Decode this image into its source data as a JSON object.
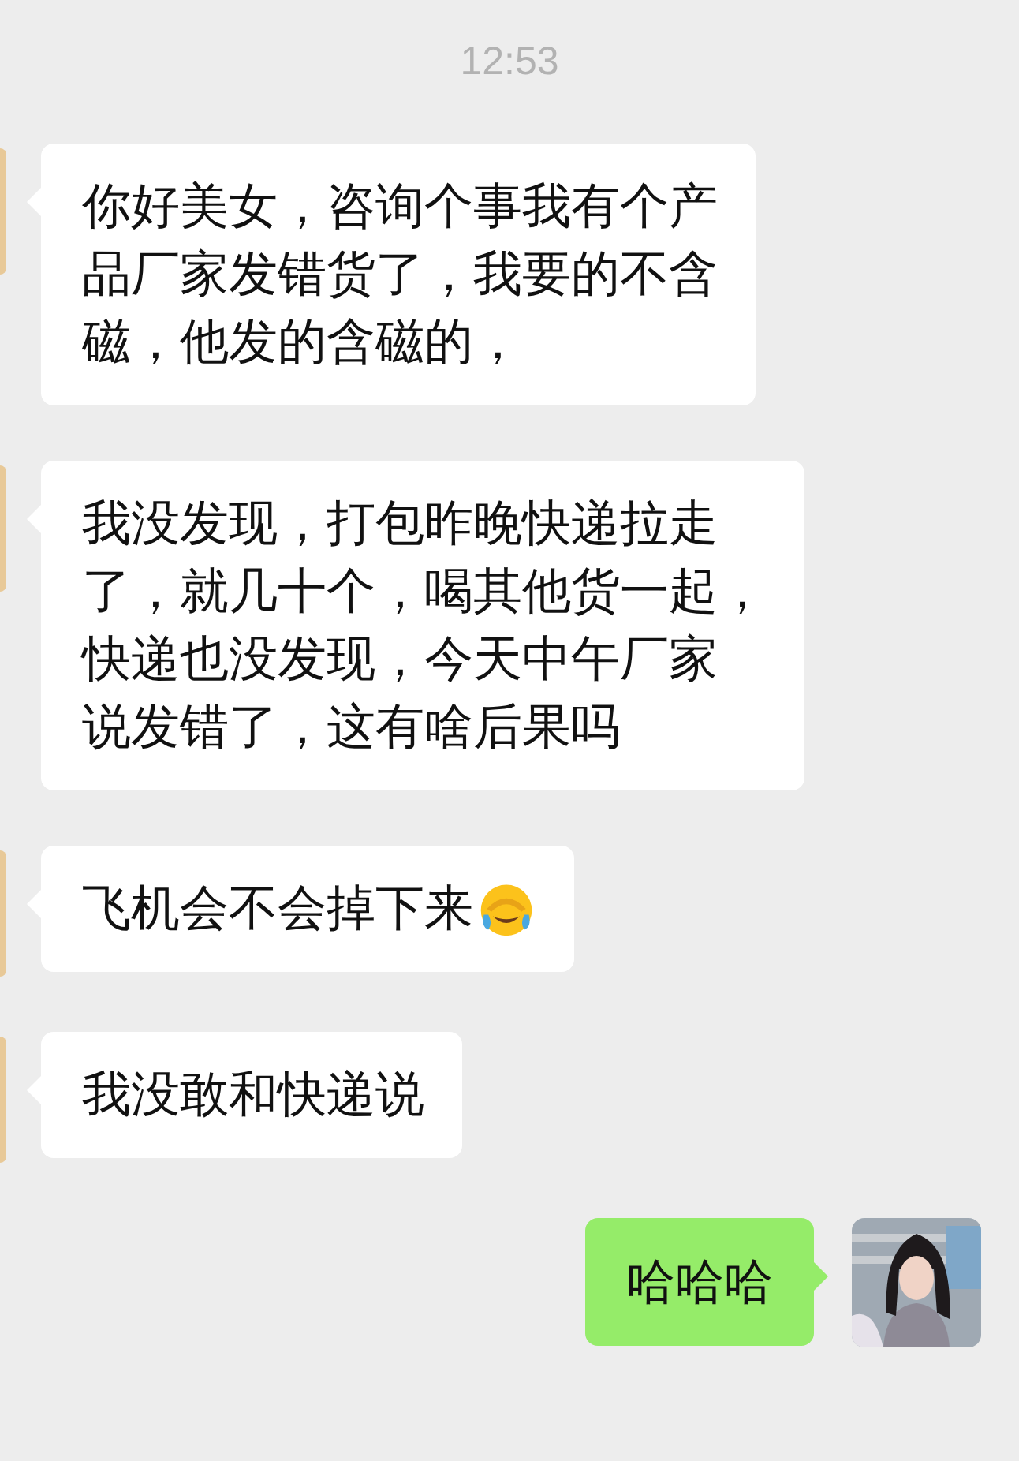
{
  "timestamp": "12:53",
  "messages": [
    {
      "kind": "incoming",
      "lines": [
        "你好美女，咨询个事我有个产",
        "品厂家发错货了，我要的不含",
        "磁，他发的含磁的，"
      ],
      "emoji": false
    },
    {
      "kind": "incoming",
      "lines": [
        "我没发现，打包昨晚快递拉走",
        "了，就几十个，喝其他货一起，",
        "快递也没发现，今天中午厂家",
        "说发错了，这有啥后果吗"
      ],
      "emoji": false
    },
    {
      "kind": "incoming",
      "lines": [
        "飞机会不会掉下来"
      ],
      "emoji": true
    },
    {
      "kind": "incoming",
      "lines": [
        "我没敢和快递说"
      ],
      "emoji": false
    },
    {
      "kind": "outgoing",
      "lines": [
        "哈哈哈"
      ],
      "emoji": false
    }
  ]
}
